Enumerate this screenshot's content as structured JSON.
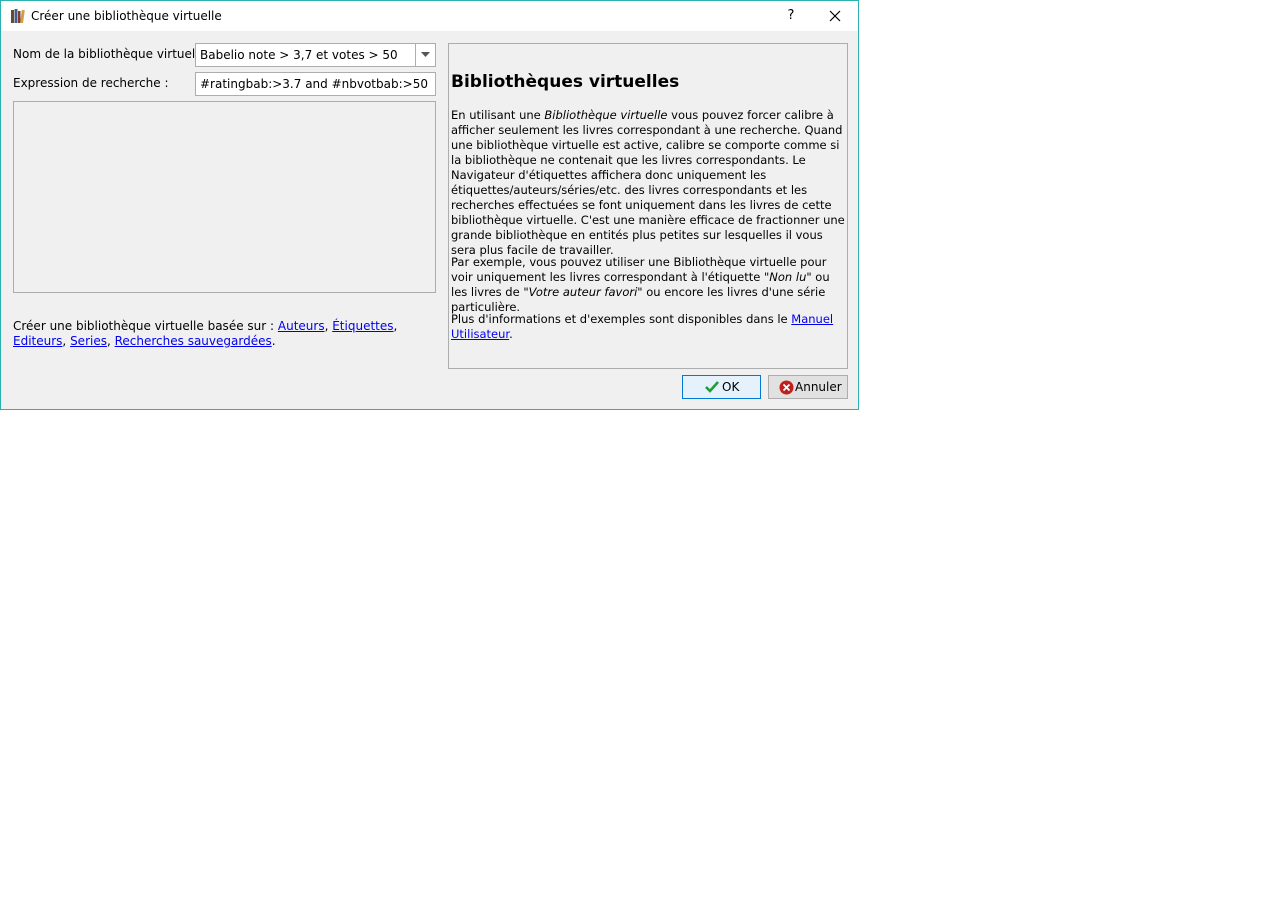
{
  "window": {
    "title": "Créer une bibliothèque virtuelle",
    "help_glyph": "?"
  },
  "form": {
    "name_label": "Nom de la bibliothèque virtuelle :",
    "name_value": "Babelio note > 3,7 et votes > 50",
    "search_label": "Expression de recherche :",
    "search_value": "#ratingbab:>3.7 and #nbvotbab:>50"
  },
  "based_on": {
    "prefix": "Créer une bibliothèque virtuelle basée sur :",
    "links": [
      "Auteurs",
      "Étiquettes",
      "Editeurs",
      "Series",
      "Recherches sauvegardées"
    ]
  },
  "help": {
    "heading": "Bibliothèques virtuelles",
    "p1_a": "En utilisant une ",
    "p1_italic": "Bibliothèque virtuelle",
    "p1_b": " vous pouvez forcer calibre à afficher seulement les livres correspondant à une recherche. Quand une bibliothèque virtuelle est active, calibre se comporte comme si la bibliothèque ne contenait que les livres correspondants. Le Navigateur d'étiquettes affichera donc uniquement les étiquettes/auteurs/séries/etc. des livres correspondants et les recherches effectuées se font uniquement dans les livres de cette bibliothèque virtuelle. C'est une manière efficace de fractionner une grande bibliothèque en entités plus petites sur lesquelles il vous sera plus facile de travailler.",
    "p2_a": "Par exemple, vous pouvez utiliser une Bibliothèque virtuelle pour voir uniquement les livres correspondant à l'étiquette ",
    "p2_italic1": "\"Non lu\"",
    "p2_b": " ou les livres de ",
    "p2_italic2": "\"Votre auteur favori\"",
    "p2_c": " ou encore les livres d'une série particulière.",
    "p3_a": "Plus d'informations et d'exemples sont disponibles dans le ",
    "p3_link": "Manuel Utilisateur",
    "p3_end": "."
  },
  "buttons": {
    "ok": "OK",
    "cancel": "Annuler"
  },
  "colors": {
    "window_border": "#2bb0b0",
    "link": "#0000ee",
    "ok_check": "#1f9e3a",
    "cancel_icon": "#c0201c"
  }
}
